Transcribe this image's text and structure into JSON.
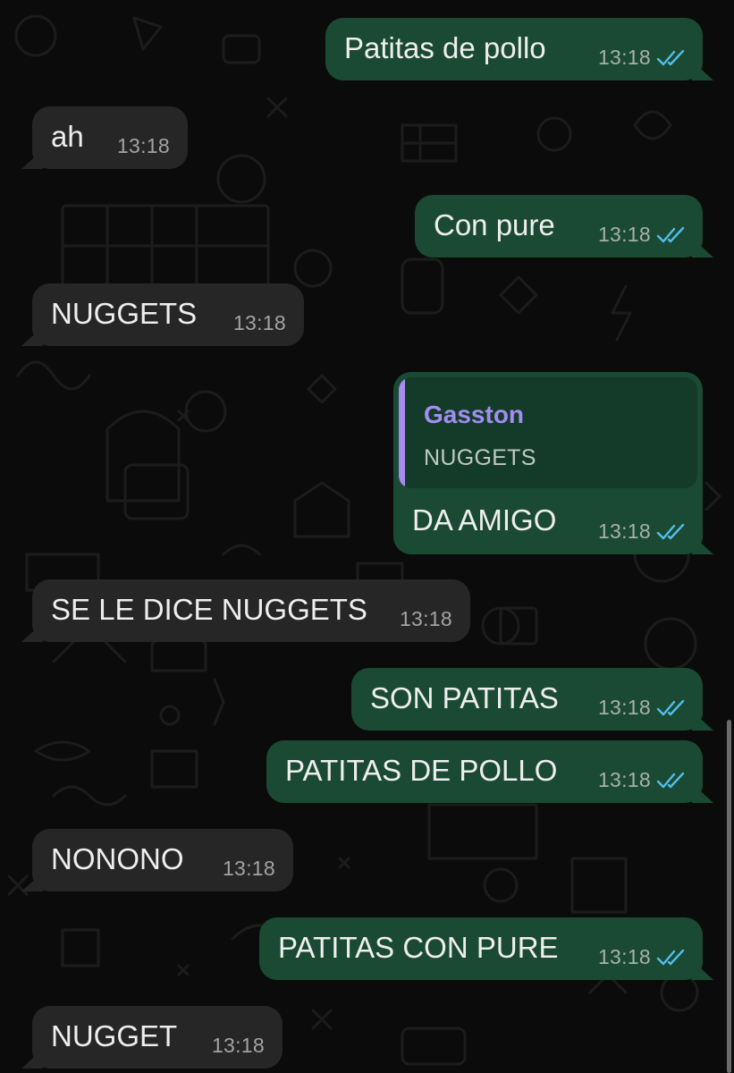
{
  "theme": {
    "background": "#0b0b0b",
    "incoming_bubble": "#262626",
    "outgoing_bubble": "#1a4a34",
    "quote_accent": "#a98bf0",
    "read_ticks": "#53bdeb"
  },
  "messages": [
    {
      "direction": "outgoing",
      "text": "Patitas de pollo",
      "time": "13:18",
      "status": "read"
    },
    {
      "direction": "incoming",
      "text": "ah",
      "time": "13:18"
    },
    {
      "direction": "outgoing",
      "text": "Con pure",
      "time": "13:18",
      "status": "read"
    },
    {
      "direction": "incoming",
      "text": "NUGGETS",
      "time": "13:18"
    },
    {
      "direction": "outgoing",
      "text": "DA AMIGO",
      "time": "13:18",
      "status": "read",
      "reply_to": {
        "author": "Gasston",
        "text": "NUGGETS"
      }
    },
    {
      "direction": "incoming",
      "text": "SE LE DICE NUGGETS",
      "time": "13:18"
    },
    {
      "direction": "outgoing",
      "text": "SON PATITAS",
      "time": "13:18",
      "status": "read"
    },
    {
      "direction": "outgoing",
      "text": "PATITAS DE POLLO",
      "time": "13:18",
      "status": "read"
    },
    {
      "direction": "incoming",
      "text": "NONONO",
      "time": "13:18"
    },
    {
      "direction": "outgoing",
      "text": "PATITAS CON PURE",
      "time": "13:18",
      "status": "read"
    },
    {
      "direction": "incoming",
      "text": "NUGGET",
      "time": "13:18"
    }
  ]
}
